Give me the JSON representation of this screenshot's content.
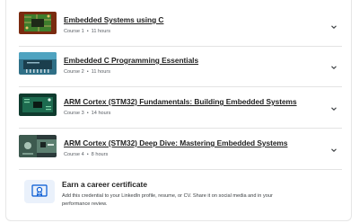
{
  "courses": [
    {
      "title": "Embedded Systems using C",
      "course_label": "Course 1",
      "duration": "11 hours",
      "thumbnail_icon": "circuit-board-thumbnail"
    },
    {
      "title": "Embedded C Programming Essentials",
      "course_label": "Course 2",
      "duration": "11 hours",
      "thumbnail_icon": "microcontroller-thumbnail"
    },
    {
      "title": "ARM Cortex (STM32) Fundamentals: Building Embedded Systems",
      "course_label": "Course 3",
      "duration": "14 hours",
      "thumbnail_icon": "dev-board-thumbnail"
    },
    {
      "title": "ARM Cortex (STM32) Deep Dive: Mastering Embedded Systems",
      "course_label": "Course 4",
      "duration": "8 hours",
      "thumbnail_icon": "electronics-thumbnail"
    }
  ],
  "separator": "•",
  "certificate": {
    "title": "Earn a career certificate",
    "description": "Add this credential to your LinkedIn profile, resume, or CV. Share it on social media and in your performance review.",
    "icon": "certificate-icon"
  },
  "colors": {
    "accent": "#0056d2",
    "icon_bg": "#eaf1fb",
    "text": "#1f1f1f",
    "muted": "#5b6066"
  }
}
